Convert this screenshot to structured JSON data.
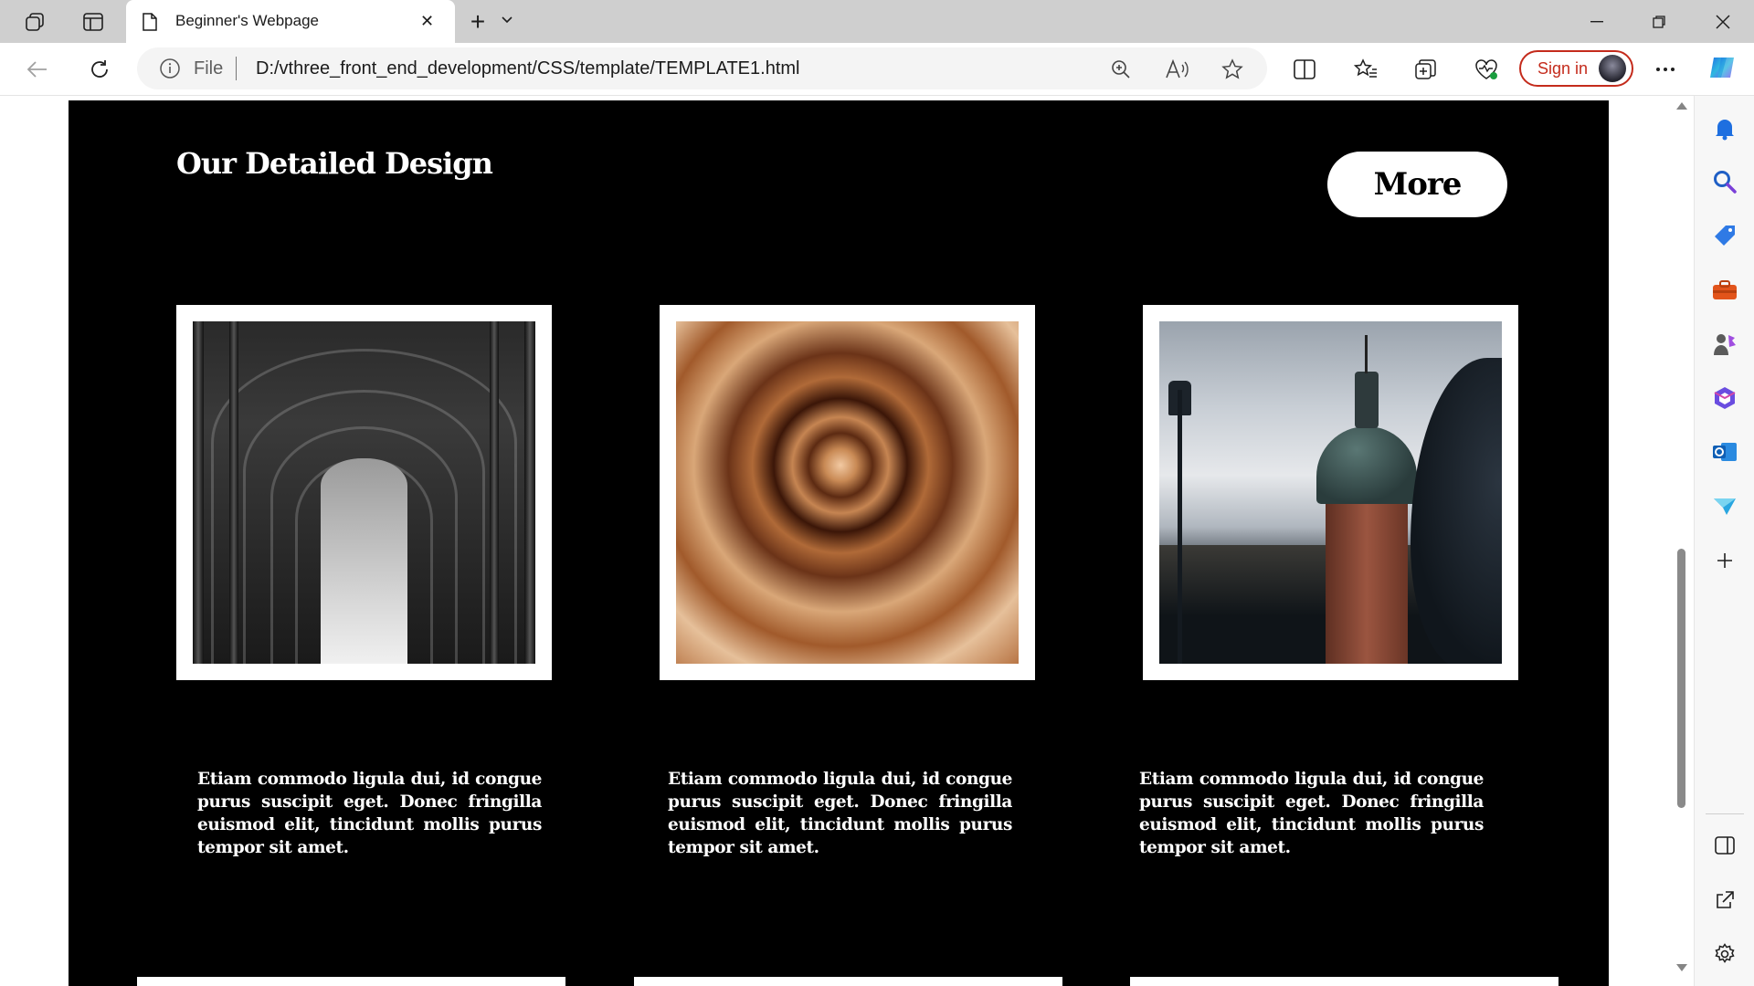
{
  "browser": {
    "tab_title": "Beginner's Webpage",
    "address_scheme": "File",
    "url": "D:/vthree_front_end_development/CSS/template/TEMPLATE1.html",
    "signin_label": "Sign in"
  },
  "page": {
    "section_title": "Our Detailed Design",
    "more_label": "More",
    "cards": [
      {
        "image": "cathedral-arches",
        "text": "Etiam commodo ligula dui, id congue purus suscipit eget. Donec fringilla euismod elit, tincidunt mollis purus tempor sit amet."
      },
      {
        "image": "spiral-staircase",
        "text": "Etiam commodo ligula dui, id congue purus suscipit eget. Donec fringilla euismod elit, tincidunt mollis purus tempor sit amet."
      },
      {
        "image": "domed-tower",
        "text": "Etiam commodo ligula dui, id congue purus suscipit eget. Donec fringilla euismod elit, tincidunt mollis purus tempor sit amet."
      }
    ]
  },
  "colors": {
    "section_bg": "#000000",
    "accent_signin": "#c42b1c",
    "tabstrip_bg": "#cfcfcf"
  }
}
